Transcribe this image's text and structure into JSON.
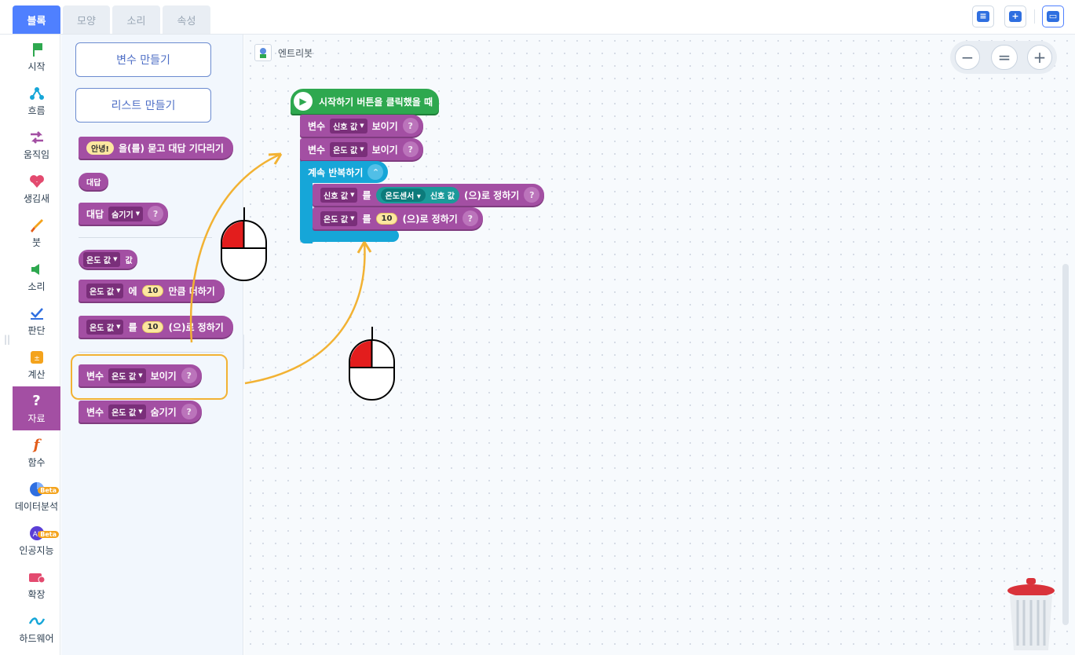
{
  "tabs": [
    "블록",
    "모양",
    "소리",
    "속성"
  ],
  "toolbar": {
    "icons": [
      "comment-icon",
      "add-comment-icon",
      "storage-icon"
    ]
  },
  "categories": [
    {
      "label": "시작",
      "icon": "flag-icon",
      "color": "#2ea84f"
    },
    {
      "label": "흐름",
      "icon": "flow-icon",
      "color": "#16a6d8"
    },
    {
      "label": "움직임",
      "icon": "move-icon",
      "color": "#a34fa3"
    },
    {
      "label": "생김새",
      "icon": "looks-icon",
      "color": "#e34a6f"
    },
    {
      "label": "붓",
      "icon": "brush-icon",
      "color": "#f4a31c"
    },
    {
      "label": "소리",
      "icon": "sound-icon",
      "color": "#2ea84f"
    },
    {
      "label": "판단",
      "icon": "check-icon",
      "color": "#2f6fe0"
    },
    {
      "label": "계산",
      "icon": "calc-icon",
      "color": "#f4a31c"
    },
    {
      "label": "자료",
      "icon": "question-icon",
      "color": "#ffffff"
    },
    {
      "label": "함수",
      "icon": "function-icon",
      "color": "#e35d1a"
    },
    {
      "label": "데이터분석",
      "icon": "chart-pie-icon",
      "color": "#2f6fe0",
      "badge": "Beta"
    },
    {
      "label": "인공지능",
      "icon": "ai-icon",
      "color": "#5b3fd6",
      "badge": "Beta"
    },
    {
      "label": "확장",
      "icon": "extension-icon",
      "color": "#e34a6f"
    },
    {
      "label": "하드웨어",
      "icon": "hardware-icon",
      "color": "#16a6d8"
    }
  ],
  "palette": {
    "make_variable": "변수 만들기",
    "make_list": "리스트 만들기",
    "ask_default": "안녕!",
    "ask_text": "을(를) 묻고 대답 기다리기",
    "answer": "대답",
    "answer_label": "대답",
    "answer_option": "숨기기",
    "var_name": "온도 값",
    "value_label": "값",
    "add_on": "에",
    "add_text": "만큼 더하기",
    "set_on": "를",
    "set_text": "(으)로 정하기",
    "num": "10",
    "var_label": "변수",
    "show_text": "보이기",
    "hide_text": "숨기기",
    "help": "?"
  },
  "canvas": {
    "object_name": "엔트리봇",
    "start_text": "시작하기 버튼을 클릭했을 때",
    "var_label": "변수",
    "var1": "신호 값",
    "var2": "온도 값",
    "show_text": "보이기",
    "loop_text": "계속 반복하기",
    "set_on": "를",
    "sensor": "온도센서",
    "sensor_value": "신호 값",
    "set_text": "(으)로 정하기",
    "num": "10",
    "help": "?"
  },
  "zoom": {
    "out": "−",
    "reset": "=",
    "in": "+"
  }
}
